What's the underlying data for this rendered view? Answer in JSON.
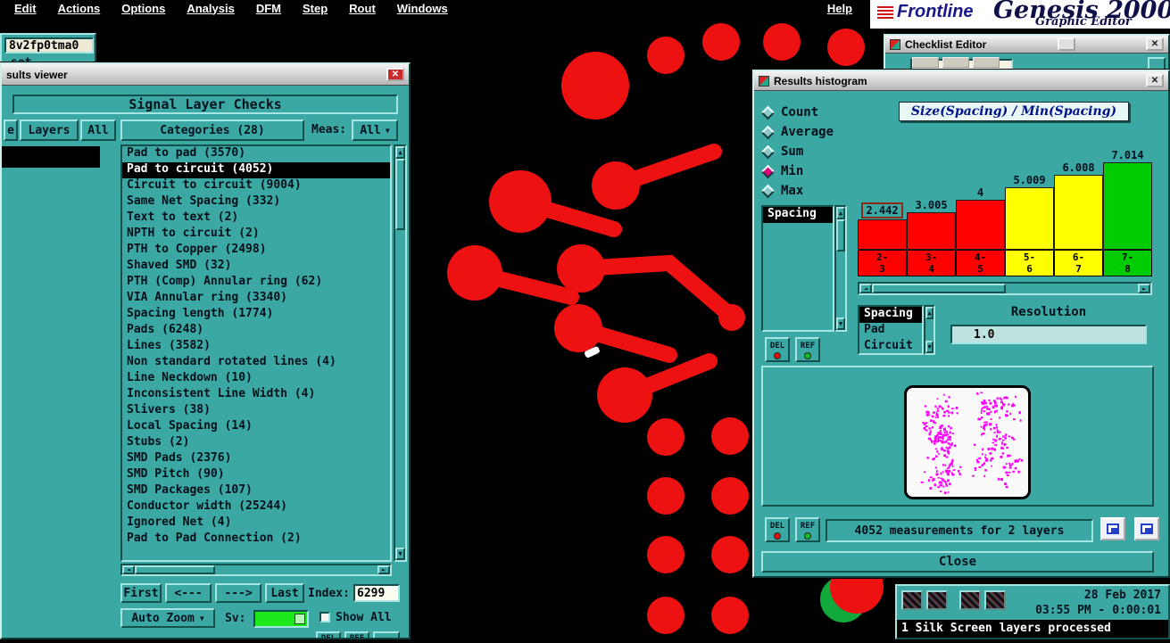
{
  "colors": {
    "teal": "#3ba8a4",
    "trace_red": "#ee1111",
    "pad_green": "#11a83c",
    "speckle_magenta": "#ff00ff"
  },
  "icons": {
    "close": "✕",
    "arrow_up": "▲",
    "arrow_down": "▼",
    "arrow_left": "◄",
    "arrow_right": "►",
    "dropdown": "▼"
  },
  "menubar": {
    "items": [
      "Edit",
      "Actions",
      "Options",
      "Analysis",
      "DFM",
      "Step",
      "Rout",
      "Windows"
    ],
    "help": "Help"
  },
  "brand": {
    "logo": "Frontline",
    "product": "Genesis 2000",
    "subtitle": "Graphic Editor"
  },
  "job_panel": {
    "job": "8v2fp0tma0",
    "step": "set"
  },
  "results_viewer": {
    "window_title": "sults viewer",
    "header": "Signal Layer Checks",
    "side_tab": "e",
    "layers_button": "Layers",
    "layers_all_button": "All",
    "categories_header": "Categories (28)",
    "meas_label": "Meas:",
    "meas_value": "All",
    "categories": [
      "Pad to pad (3570)",
      "Pad to circuit (4052)",
      "Circuit to circuit (9004)",
      "Same Net Spacing (332)",
      "Text to text (2)",
      "NPTH to circuit (2)",
      "PTH to Copper (2498)",
      "Shaved SMD (32)",
      "PTH (Comp) Annular ring (62)",
      "VIA Annular ring (3340)",
      "Spacing length (1774)",
      "Pads (6248)",
      "Lines (3582)",
      "Non standard rotated lines (4)",
      "Line Neckdown (10)",
      "Inconsistent Line Width (4)",
      "Slivers (38)",
      "Local Spacing (14)",
      "Stubs (2)",
      "SMD Pads (2376)",
      "SMD Pitch (90)",
      "SMD Packages (107)",
      "Conductor width (25244)",
      "Ignored Net (4)",
      "Pad to Pad Connection (2)"
    ],
    "selected_category_index": 1,
    "nav": {
      "first": "First",
      "prev": "<---",
      "next": "--->",
      "last": "Last",
      "index_label": "Index:",
      "index_value": "6299"
    },
    "footer": {
      "auto_zoom": "Auto Zoom",
      "sv_label": "Sv:",
      "show_all": "Show All"
    },
    "bottom_partial": [
      "DEL",
      "REF"
    ]
  },
  "histogram_window": {
    "window_title": "Results histogram",
    "stats": [
      "Count",
      "Average",
      "Sum",
      "Min",
      "Max"
    ],
    "selected_stat_index": 3,
    "measure_list": [
      "Spacing"
    ],
    "selected_measure_index": 0,
    "del_button": "DEL",
    "ref_button": "REF",
    "param_list": [
      "Spacing",
      "Pad",
      "Circuit"
    ],
    "selected_param_index": 0,
    "resolution_label": "Resolution",
    "resolution_value": "1.0",
    "measurements_text": "4052 measurements for 2 layers",
    "close_button": "Close"
  },
  "chart_data": {
    "type": "bar",
    "title": "Size(Spacing) / Min(Spacing)",
    "categories": [
      "2-3",
      "3-4",
      "4-5",
      "5-6",
      "6-7",
      "7-8"
    ],
    "values": [
      2.442,
      3.005,
      4,
      5.009,
      6.008,
      7.014
    ],
    "bar_labels": [
      "2.442",
      "3.005",
      "4",
      "5.009",
      "6.008",
      "7.014"
    ],
    "bar_colors": [
      "#ff0000",
      "#ff0000",
      "#ff0000",
      "#ffff00",
      "#ffff00",
      "#00cc00"
    ],
    "highlighted_bar_index": 0,
    "xlabel": "",
    "ylabel": "",
    "ylim": [
      0,
      7.5
    ],
    "legend_position": "none",
    "grid": false
  },
  "checklist_window": {
    "window_title": "Checklist Editor"
  },
  "status_panel": {
    "date": "28 Feb 2017",
    "time": "03:55 PM - 0:00:01",
    "message": "1 Silk Screen layers processed"
  }
}
